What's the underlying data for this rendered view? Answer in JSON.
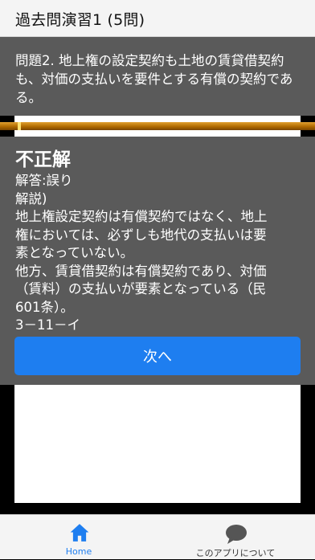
{
  "header": {
    "title": "過去問演習1 (5問)"
  },
  "question": {
    "text": "問題2. 地上権の設定契約も土地の賃貸借契約も、対価の支払いを要件とする有償の契約である。"
  },
  "progress": {
    "fraction": 1.0
  },
  "result": {
    "title": "不正解",
    "lines": [
      "解答:誤り",
      "解説)",
      "地上権設定契約は有償契約ではなく、地上",
      "権においては、必ずしも地代の支払いは要",
      "素となっていない。",
      "他方、賃貸借契約は有償契約であり、対価",
      "（賃料）の支払いが要素となっている（民",
      "601条）。",
      "3－11－イ"
    ]
  },
  "next_button": {
    "label": "次へ"
  },
  "tabbar": {
    "home": {
      "label": "Home",
      "icon": "home-icon",
      "color": "#1e7ef0"
    },
    "about": {
      "label": "このアプリについて",
      "icon": "chat-bubble-icon"
    }
  }
}
